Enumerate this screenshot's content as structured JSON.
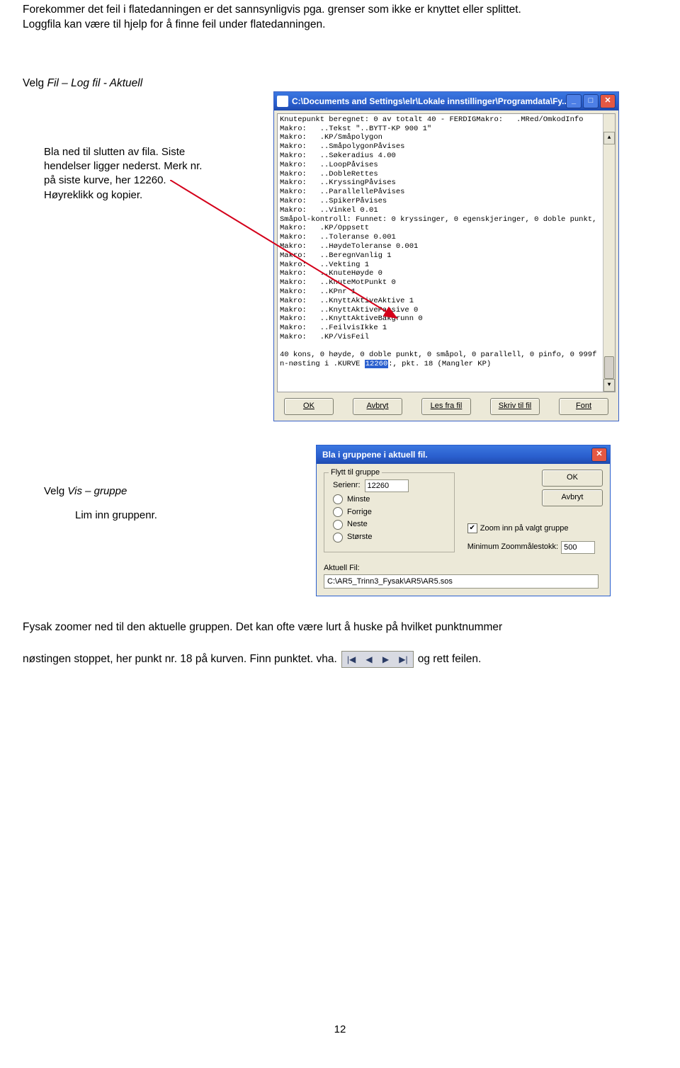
{
  "intro": {
    "line1": "Forekommer det feil i flatedanningen er det sannsynligvis pga. grenser som ikke er knyttet eller splittet.",
    "line2": "Loggfila kan være til hjelp for å finne feil under flatedanningen."
  },
  "step1": {
    "prefix": "Velg ",
    "menu": "Fil – Log fil - Aktuell"
  },
  "callout1": {
    "l1": "Bla ned til slutten av fila. Siste",
    "l2": "hendelser ligger nederst. Merk nr.",
    "l3": "på siste kurve, her 12260.",
    "l4": "Høyreklikk og kopier."
  },
  "logwin": {
    "title": "C:\\Documents and Settings\\elr\\Lokale innstillinger\\Programdata\\Fy...",
    "lines_top": "Knutepunkt beregnet: 0 av totalt 40 - FERDIGMakro:   .MRed/OmkodInfo",
    "lines": [
      "Makro:   ..Tekst \"..BYTT-KP 900 1\"",
      "Makro:   .KP/Småpolygon",
      "Makro:   ..SmåpolygonPåvises",
      "Makro:   ..Søkeradius 4.00",
      "Makro:   ..LoopPåvises",
      "Makro:   ..DobleRettes",
      "Makro:   ..KryssingPåvises",
      "Makro:   ..ParallellePåvises",
      "Makro:   ..SpikerPåvises",
      "Makro:   ..Vinkel 0.01",
      "Småpol-kontroll: Funnet: 0 kryssinger, 0 egenskjeringer, 0 doble punkt,",
      "Makro:   .KP/Oppsett",
      "Makro:   ..Toleranse 0.001",
      "Makro:   ..HøydeToleranse 0.001",
      "Makro:   ..BeregnVanlig 1",
      "Makro:   ..Vekting 1",
      "Makro:   ..KnuteHøyde 0",
      "Makro:   ..KnuteMotPunkt 0",
      "Makro:   ..KPnr 1",
      "Makro:   ..KnyttAktiveAktive 1",
      "Makro:   ..KnyttAktivePassive 0",
      "Makro:   ..KnyttAktiveBakgrunn 0",
      "Makro:   ..FeilvisIkke 1",
      "Makro:   .KP/VisFeil",
      "",
      "40 kons, 0 høyde, 0 doble punkt, 0 småpol, 0 parallell, 0 pinfo, 0 999f"
    ],
    "selline_pre": "n-nøsting i .KURVE ",
    "selline_sel": "12260",
    "selline_post": ":, pkt. 18 (Mangler KP)",
    "buttons": {
      "ok": "OK",
      "avbryt": "Avbryt",
      "lesfra": "Les fra fil",
      "skriv": "Skriv til fil",
      "font": "Font"
    }
  },
  "step2": {
    "prefix": "Velg ",
    "menu": "Vis – gruppe",
    "sub": "Lim inn gruppenr."
  },
  "dlg": {
    "title": "Bla i gruppene i aktuell fil.",
    "legend": "Flytt til gruppe",
    "serienr_label": "Serienr:",
    "serienr_value": "12260",
    "r_minste": "Minste",
    "r_forrige": "Forrige",
    "r_neste": "Neste",
    "r_storste": "Største",
    "ok": "OK",
    "avbryt": "Avbryt",
    "zoom_chk": "Zoom inn på valgt gruppe",
    "minzoom_label": "Minimum Zoommålestokk:",
    "minzoom_value": "500",
    "aktuell_label": "Aktuell Fil:",
    "aktuell_path": "C:\\AR5_Trinn3_Fysak\\AR5\\AR5.sos"
  },
  "after": {
    "l1": "Fysak zoomer ned til den aktuelle gruppen. Det kan ofte være lurt å huske på hvilket punktnummer",
    "l2a": "nøstingen stoppet, her punkt nr. 18 på kurven. Finn punktet. vha. ",
    "l2b": " og rett feilen."
  },
  "nav_icons": [
    "|◀",
    "◀",
    "▶",
    "▶|"
  ],
  "page_number": "12"
}
